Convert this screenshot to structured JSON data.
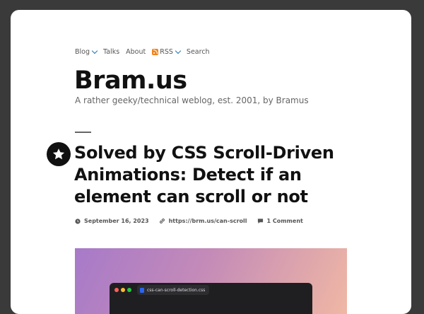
{
  "nav": {
    "items": [
      {
        "label": "Blog",
        "has_dropdown": true
      },
      {
        "label": "Talks",
        "has_dropdown": false
      },
      {
        "label": "About",
        "has_dropdown": false
      },
      {
        "label": "RSS",
        "has_dropdown": true,
        "icon": "rss-icon"
      },
      {
        "label": "Search",
        "has_dropdown": false
      }
    ]
  },
  "site": {
    "title": "Bram.us",
    "tagline": "A rather geeky/technical weblog, est. 2001, by Bramus"
  },
  "post": {
    "title": "Solved by CSS Scroll-Driven Animations: Detect if an element can scroll or not",
    "date": "September 16, 2023",
    "shortlink": "https://brm.us/can-scroll",
    "comments": "1 Comment"
  },
  "hero": {
    "tab_label": "css-can-scroll-detection.css",
    "colors": {
      "dot_red": "#ff5f57",
      "dot_yellow": "#febc2e",
      "dot_green": "#28c840"
    }
  },
  "colors": {
    "accent": "#1f79b7",
    "rss": "#f2841b",
    "background": "#3a3a3a"
  }
}
